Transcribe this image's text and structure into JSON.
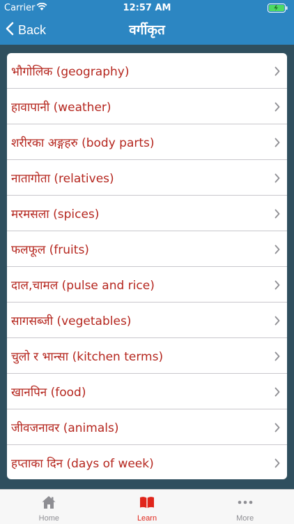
{
  "status_bar": {
    "carrier": "Carrier",
    "time": "12:57 AM"
  },
  "nav": {
    "back_label": "Back",
    "title": "वर्गीकृत"
  },
  "categories": [
    "भौगोलिक (geography)",
    "हावापानी (weather)",
    "शरीरका अङ्गहरु (body parts)",
    "नातागोता (relatives)",
    "मरमसला (spices)",
    "फलफूल (fruits)",
    "दाल,चामल (pulse and rice)",
    "सागसब्जी (vegetables)",
    "चुलो र भान्सा (kitchen terms)",
    "खानपिन (food)",
    "जीवजनावर (animals)",
    "हप्ताका दिन (days of week)"
  ],
  "tabs": [
    {
      "label": "Home",
      "icon": "home-icon"
    },
    {
      "label": "Learn",
      "icon": "book-icon",
      "active": true
    },
    {
      "label": "More",
      "icon": "more-dots-icon"
    }
  ],
  "colors": {
    "nav_blue": "#2c86c2",
    "accent_red": "#b5261e",
    "tab_active": "#e0251b",
    "background": "#2f4f5e"
  }
}
